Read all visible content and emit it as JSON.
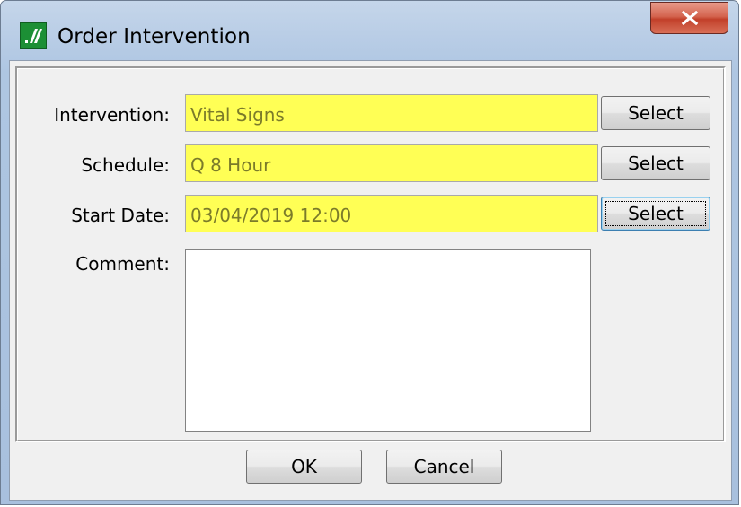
{
  "window": {
    "title": "Order Intervention",
    "app_icon": "app-logo-icon",
    "close_icon": "close-icon"
  },
  "form": {
    "intervention": {
      "label": "Intervention:",
      "value": "Vital Signs",
      "button": "Select"
    },
    "schedule": {
      "label": "Schedule:",
      "value": "Q 8 Hour",
      "button": "Select"
    },
    "start_date": {
      "label": "Start Date:",
      "value": "03/04/2019 12:00",
      "button": "Select"
    },
    "comment": {
      "label": "Comment:",
      "value": ""
    }
  },
  "footer": {
    "ok_label": "OK",
    "cancel_label": "Cancel"
  },
  "colors": {
    "required_field": "#ffff55",
    "close_button": "#c2402a",
    "app_icon": "#1c8f35"
  }
}
